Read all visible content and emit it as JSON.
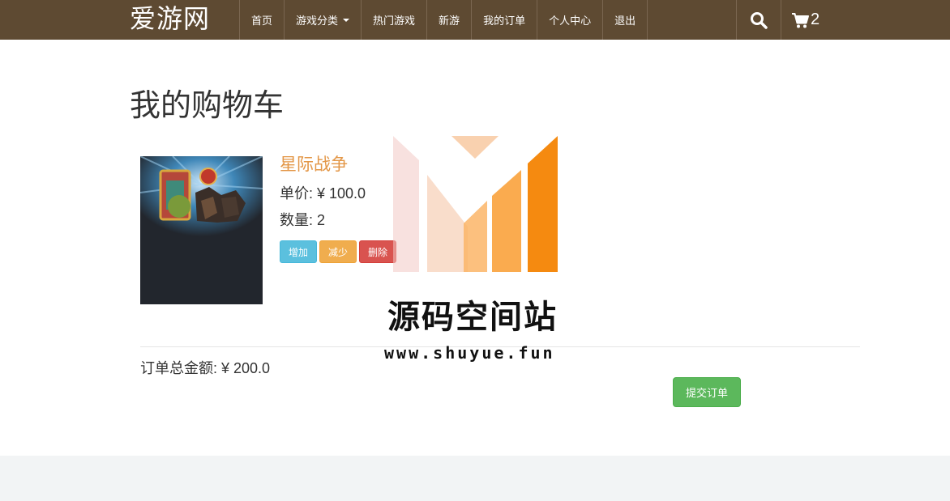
{
  "brand": {
    "name": "爱游网"
  },
  "nav": {
    "items": [
      {
        "label": "首页"
      },
      {
        "label": "游戏分类"
      },
      {
        "label": "热门游戏"
      },
      {
        "label": "新游"
      },
      {
        "label": "我的订单"
      },
      {
        "label": "个人中心"
      },
      {
        "label": "退出"
      }
    ],
    "cart_count": "2"
  },
  "page": {
    "title": "我的购物车"
  },
  "cart": {
    "items": [
      {
        "name": "星际战争",
        "price_text": "单价: ¥ 100.0",
        "quantity_text": "数量: 2",
        "buttons": {
          "increase": "增加",
          "decrease": "减少",
          "delete": "删除"
        }
      }
    ],
    "total_text": "订单总金额: ¥ 200.0",
    "submit_label": "提交订单"
  },
  "watermark": {
    "title": "源码空间站",
    "url": "www.shuyue.fun"
  },
  "colors": {
    "navbar": "#5e4a32",
    "product_name": "#e39646",
    "btn_info": "#5bc0de",
    "btn_warning": "#f0ad4e",
    "btn_danger": "#d9534f",
    "btn_success": "#5cb85c",
    "footer": "#f2f4f5"
  }
}
